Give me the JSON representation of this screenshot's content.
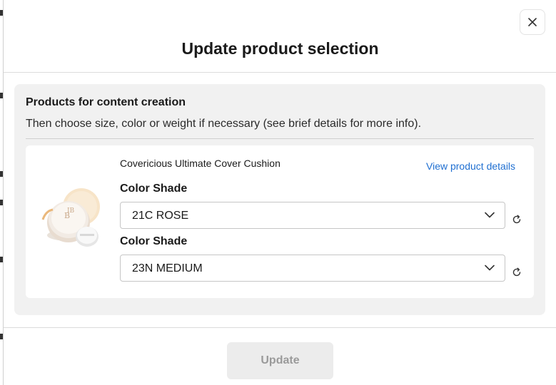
{
  "dialog": {
    "title": "Update product selection",
    "close_icon": "close-icon"
  },
  "panel": {
    "title": "Products for content creation",
    "subtitle": "Then choose size, color or weight if necessary (see brief details for more info)."
  },
  "product": {
    "name": "Covericious Ultimate Cover Cushion",
    "view_details_label": "View product details",
    "variants": [
      {
        "label": "Color Shade",
        "value": "21C ROSE"
      },
      {
        "label": "Color Shade",
        "value": "23N MEDIUM"
      }
    ]
  },
  "footer": {
    "update_label": "Update",
    "update_disabled": true
  },
  "colors": {
    "link": "#1f6fd1",
    "disabled_button_bg": "#ececec",
    "panel_bg": "#f1f1f1"
  }
}
